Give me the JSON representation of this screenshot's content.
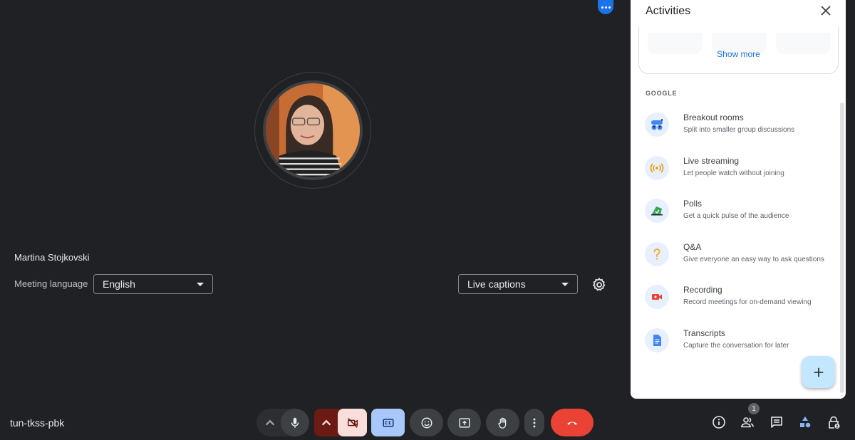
{
  "stage": {
    "participant_name": "Martina Stojkovski",
    "meeting_language_label": "Meeting language",
    "meeting_language_value": "English",
    "captions_value": "Live captions"
  },
  "panel": {
    "title": "Activities",
    "show_more": "Show more",
    "section_label": "GOOGLE",
    "items": [
      {
        "title": "Breakout rooms",
        "desc": "Split into smaller group discussions",
        "icon": "breakout-rooms-icon"
      },
      {
        "title": "Live streaming",
        "desc": "Let people watch without joining",
        "icon": "live-streaming-icon"
      },
      {
        "title": "Polls",
        "desc": "Get a quick pulse of the audience",
        "icon": "polls-icon"
      },
      {
        "title": "Q&A",
        "desc": "Give everyone an easy way to ask questions",
        "icon": "qa-icon"
      },
      {
        "title": "Recording",
        "desc": "Record meetings for on-demand viewing",
        "icon": "recording-icon"
      },
      {
        "title": "Transcripts",
        "desc": "Capture the conversation for later",
        "icon": "transcripts-icon"
      }
    ]
  },
  "bottom_bar": {
    "meeting_code": "tun-tkss-pbk",
    "people_count": "1"
  },
  "colors": {
    "background": "#202124",
    "accent": "#1a73e8",
    "end_call": "#ea4335",
    "captions_active": "#a8c7fa",
    "camera_off": "#f9dedc"
  }
}
